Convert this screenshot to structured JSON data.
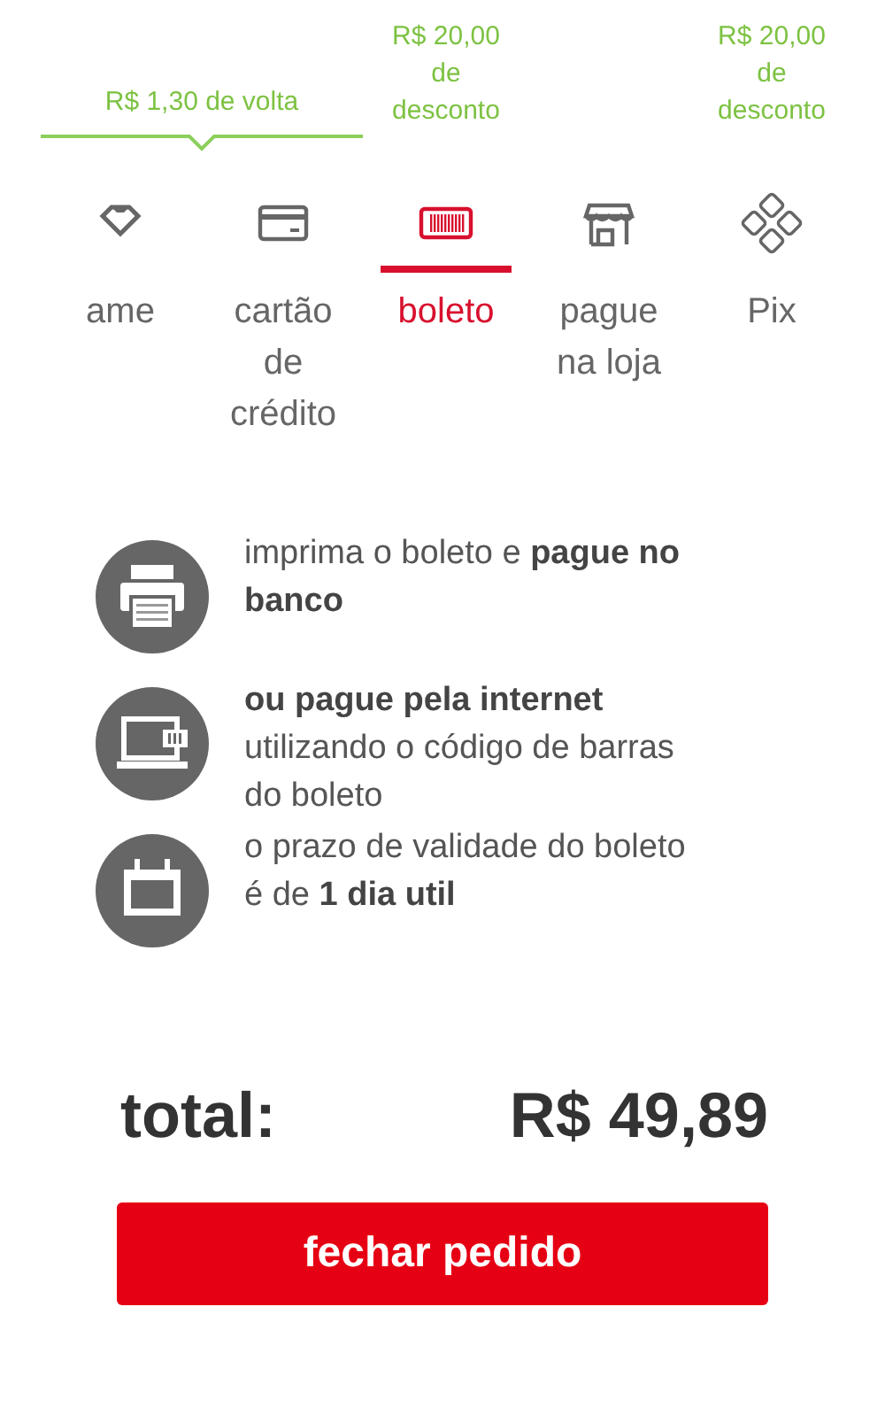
{
  "tabs": [
    {
      "label": "ame",
      "kind": "ame",
      "selected": false,
      "promo": {
        "text": "R$ 1,30 de volta",
        "kind": "cashback"
      }
    },
    {
      "label": "cartão de crédito",
      "kind": "card",
      "selected": false
    },
    {
      "label": "boleto",
      "kind": "barcode",
      "selected": true,
      "promo": {
        "text": "R$ 20,00 de desconto",
        "kind": "discount"
      }
    },
    {
      "label": "pague na loja",
      "kind": "store",
      "selected": false
    },
    {
      "label": "Pix",
      "kind": "pix",
      "selected": false,
      "promo": {
        "text": "R$ 20,00 de desconto",
        "kind": "discount"
      }
    }
  ],
  "instructions": [
    {
      "kind": "printer",
      "text": "imprima o boleto e **pague no banco**"
    },
    {
      "kind": "laptop",
      "text": "**ou pague pela internet** utilizando o código de barras do boleto"
    },
    {
      "kind": "calendar",
      "text": "o prazo de validade do boleto é de **1 dia util**"
    }
  ],
  "total": {
    "label": "total:",
    "value": "R$ 49,89"
  },
  "button": "fechar pedido"
}
